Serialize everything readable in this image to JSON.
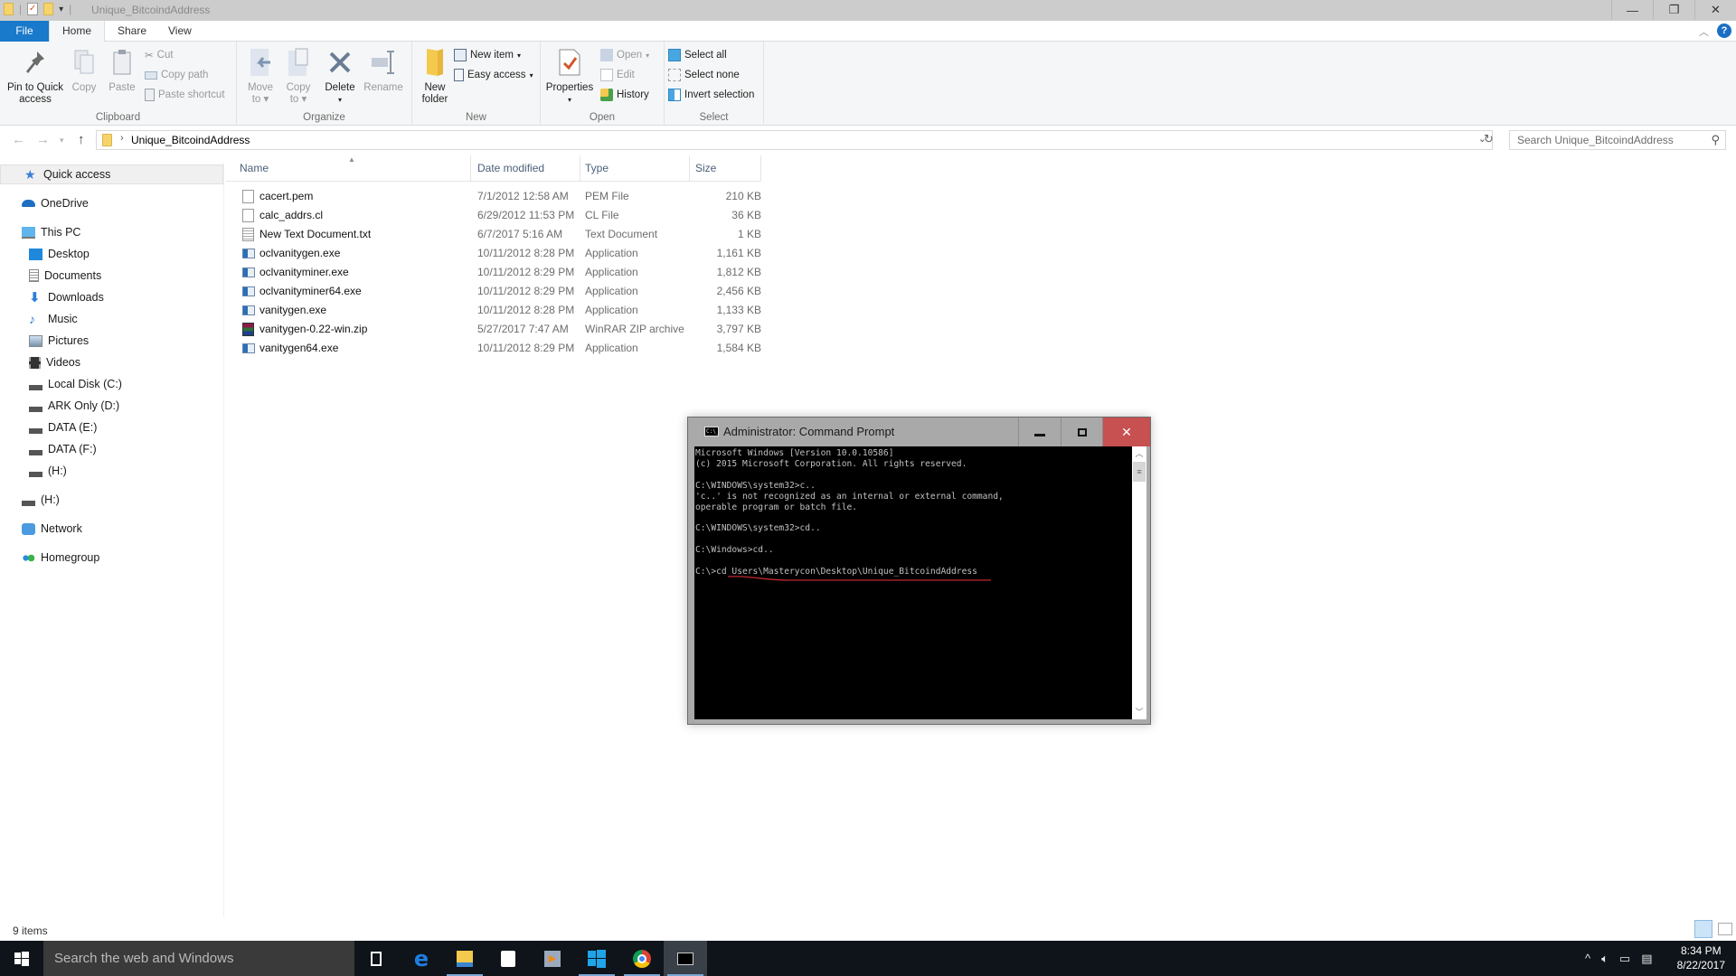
{
  "window": {
    "title": "Unique_BitcoindAddress",
    "controls": {
      "minimize": "—",
      "restore": "❐",
      "close": "✕"
    }
  },
  "ribbon": {
    "tabs": [
      {
        "label": "File"
      },
      {
        "label": "Home"
      },
      {
        "label": "Share"
      },
      {
        "label": "View"
      }
    ],
    "groups": {
      "clipboard": {
        "label": "Clipboard",
        "pin": "Pin to Quick access",
        "copy": "Copy",
        "paste": "Paste",
        "cut": "Cut",
        "copy_path": "Copy path",
        "paste_shortcut": "Paste shortcut"
      },
      "organize": {
        "label": "Organize",
        "move_to": "Move to",
        "copy_to": "Copy to",
        "delete": "Delete",
        "rename": "Rename"
      },
      "new": {
        "label": "New",
        "new_folder": "New folder",
        "new_item": "New item",
        "easy_access": "Easy access"
      },
      "open": {
        "label": "Open",
        "properties": "Properties",
        "open": "Open",
        "edit": "Edit",
        "history": "History"
      },
      "select": {
        "label": "Select",
        "select_all": "Select all",
        "select_none": "Select none",
        "invert_selection": "Invert selection"
      }
    }
  },
  "address": {
    "crumb": "Unique_BitcoindAddress",
    "search_placeholder": "Search Unique_BitcoindAddress"
  },
  "nav": {
    "items": [
      {
        "label": "Quick access",
        "icon": "star-icon"
      },
      {
        "label": "OneDrive",
        "icon": "cloud-icon"
      },
      {
        "label": "This PC",
        "icon": "computer-icon"
      },
      {
        "label": "Desktop",
        "icon": "desktop-icon"
      },
      {
        "label": "Documents",
        "icon": "documents-icon"
      },
      {
        "label": "Downloads",
        "icon": "download-icon"
      },
      {
        "label": "Music",
        "icon": "music-icon"
      },
      {
        "label": "Pictures",
        "icon": "pictures-icon"
      },
      {
        "label": "Videos",
        "icon": "videos-icon"
      },
      {
        "label": "Local Disk (C:)",
        "icon": "drive-icon"
      },
      {
        "label": "ARK Only (D:)",
        "icon": "drive-icon"
      },
      {
        "label": "DATA (E:)",
        "icon": "drive-icon"
      },
      {
        "label": "DATA (F:)",
        "icon": "drive-icon"
      },
      {
        "label": " (H:)",
        "icon": "drive-icon"
      },
      {
        "label": " (H:)",
        "icon": "drive-icon"
      },
      {
        "label": "Network",
        "icon": "network-icon"
      },
      {
        "label": "Homegroup",
        "icon": "homegroup-icon"
      }
    ]
  },
  "files": {
    "columns": [
      "Name",
      "Date modified",
      "Type",
      "Size"
    ],
    "rows": [
      {
        "name": "cacert.pem",
        "date": "7/1/2012 12:58 AM",
        "type": "PEM File",
        "size": "210 KB",
        "icon": "file-icon"
      },
      {
        "name": "calc_addrs.cl",
        "date": "6/29/2012 11:53 PM",
        "type": "CL File",
        "size": "36 KB",
        "icon": "file-icon"
      },
      {
        "name": "New Text Document.txt",
        "date": "6/7/2017 5:16 AM",
        "type": "Text Document",
        "size": "1 KB",
        "icon": "text-file-icon"
      },
      {
        "name": "oclvanitygen.exe",
        "date": "10/11/2012 8:28 PM",
        "type": "Application",
        "size": "1,161 KB",
        "icon": "application-icon"
      },
      {
        "name": "oclvanityminer.exe",
        "date": "10/11/2012 8:29 PM",
        "type": "Application",
        "size": "1,812 KB",
        "icon": "application-icon"
      },
      {
        "name": "oclvanityminer64.exe",
        "date": "10/11/2012 8:29 PM",
        "type": "Application",
        "size": "2,456 KB",
        "icon": "application-icon"
      },
      {
        "name": "vanitygen.exe",
        "date": "10/11/2012 8:28 PM",
        "type": "Application",
        "size": "1,133 KB",
        "icon": "application-icon"
      },
      {
        "name": "vanitygen-0.22-win.zip",
        "date": "5/27/2017 7:47 AM",
        "type": "WinRAR ZIP archive",
        "size": "3,797 KB",
        "icon": "winrar-archive-icon"
      },
      {
        "name": "vanitygen64.exe",
        "date": "10/11/2012 8:29 PM",
        "type": "Application",
        "size": "1,584 KB",
        "icon": "application-icon"
      }
    ]
  },
  "status": {
    "item_count": "9 items"
  },
  "cmd": {
    "title": "Administrator: Command Prompt",
    "icon_text": "C:\\_",
    "lines": [
      "Microsoft Windows [Version 10.0.10586]",
      "(c) 2015 Microsoft Corporation. All rights reserved.",
      "",
      "C:\\WINDOWS\\system32>c..",
      "'c..' is not recognized as an internal or external command,",
      "operable program or batch file.",
      "",
      "C:\\WINDOWS\\system32>cd..",
      "",
      "C:\\Windows>cd..",
      "",
      "C:\\>cd Users\\Masterycon\\Desktop\\Unique_BitcoindAddress"
    ],
    "annotation_color": "#c0282d"
  },
  "taskbar": {
    "search_placeholder": "Search the web and Windows",
    "time": "8:34 PM",
    "date": "8/22/2017"
  },
  "colors": {
    "accent": "#1979ca",
    "titlebar": "#cccccc",
    "cmd_close": "#c75050"
  }
}
